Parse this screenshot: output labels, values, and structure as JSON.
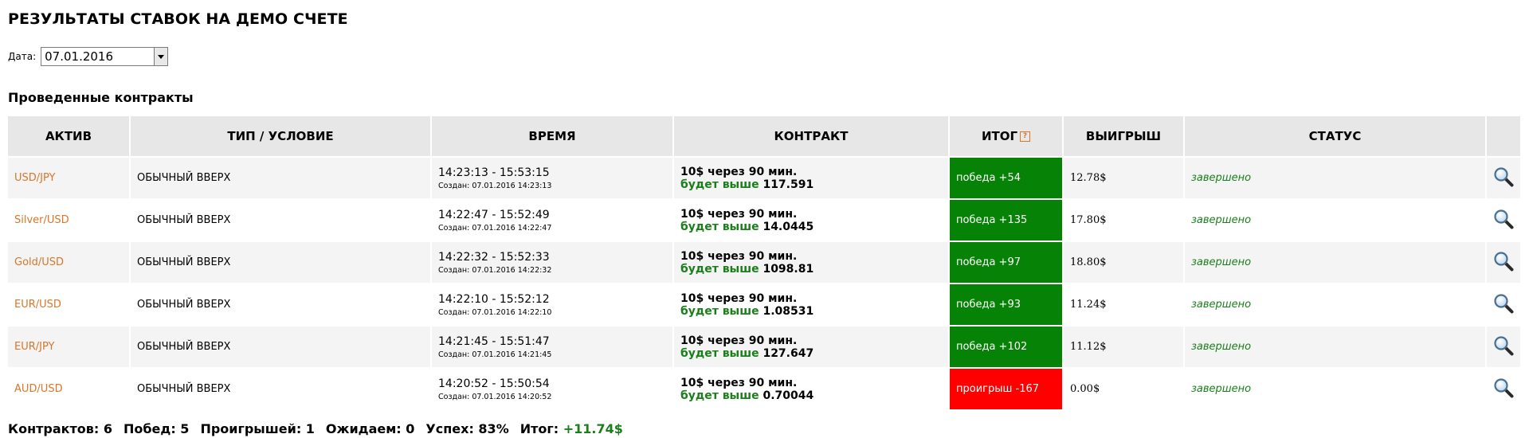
{
  "title": "РЕЗУЛЬТАТЫ СТАВОК НА ДЕМО СЧЕТЕ",
  "date": {
    "label": "Дата:",
    "value": "07.01.2016"
  },
  "section_title": "Проведенные контракты",
  "table": {
    "headers": [
      "АКТИВ",
      "ТИП / УСЛОВИЕ",
      "ВРЕМЯ",
      "КОНТРАКТ",
      "ИТОГ",
      "ВЫИГРЫШ",
      "СТАТУС",
      ""
    ],
    "rows": [
      {
        "asset": "USD/JPY",
        "type": "ОБЫЧНЫЙ ВВЕРХ",
        "time": "14:23:13 - 15:53:15",
        "created": "Создан: 07.01.2016 14:23:13",
        "contract": "10$ через 90 мин.",
        "condition": "будет выше",
        "price": "117.591",
        "result": "победа +54",
        "result_type": "win",
        "payout": "12.78$",
        "status": "завершено"
      },
      {
        "asset": "Silver/USD",
        "type": "ОБЫЧНЫЙ ВВЕРХ",
        "time": "14:22:47 - 15:52:49",
        "created": "Создан: 07.01.2016 14:22:47",
        "contract": "10$ через 90 мин.",
        "condition": "будет выше",
        "price": "14.0445",
        "result": "победа +135",
        "result_type": "win",
        "payout": "17.80$",
        "status": "завершено"
      },
      {
        "asset": "Gold/USD",
        "type": "ОБЫЧНЫЙ ВВЕРХ",
        "time": "14:22:32 - 15:52:33",
        "created": "Создан: 07.01.2016 14:22:32",
        "contract": "10$ через 90 мин.",
        "condition": "будет выше",
        "price": "1098.81",
        "result": "победа +97",
        "result_type": "win",
        "payout": "18.80$",
        "status": "завершено"
      },
      {
        "asset": "EUR/USD",
        "type": "ОБЫЧНЫЙ ВВЕРХ",
        "time": "14:22:10 - 15:52:12",
        "created": "Создан: 07.01.2016 14:22:10",
        "contract": "10$ через 90 мин.",
        "condition": "будет выше",
        "price": "1.08531",
        "result": "победа +93",
        "result_type": "win",
        "payout": "11.24$",
        "status": "завершено"
      },
      {
        "asset": "EUR/JPY",
        "type": "ОБЫЧНЫЙ ВВЕРХ",
        "time": "14:21:45 - 15:51:47",
        "created": "Создан: 07.01.2016 14:21:45",
        "contract": "10$ через 90 мин.",
        "condition": "будет выше",
        "price": "127.647",
        "result": "победа +102",
        "result_type": "win",
        "payout": "11.12$",
        "status": "завершено"
      },
      {
        "asset": "AUD/USD",
        "type": "ОБЫЧНЫЙ ВВЕРХ",
        "time": "14:20:52 - 15:50:54",
        "created": "Создан: 07.01.2016 14:20:52",
        "contract": "10$ через 90 мин.",
        "condition": "будет выше",
        "price": "0.70044",
        "result": "проигрыш -167",
        "result_type": "loss",
        "payout": "0.00$",
        "status": "завершено"
      }
    ]
  },
  "summary": {
    "contracts": "Контрактов: 6",
    "wins": "Побед: 5",
    "losses": "Проигрышей: 1",
    "pending": "Ожидаем: 0",
    "success": "Успех: 83%",
    "total_label": "Итог:",
    "total_value": "+11.74$"
  },
  "icons": {
    "help": "question-icon",
    "details": "magnifier-icon"
  },
  "colors": {
    "asset": "#d8762a",
    "win": "#068206",
    "loss": "#ff0000",
    "positive": "#1a7f1a"
  }
}
